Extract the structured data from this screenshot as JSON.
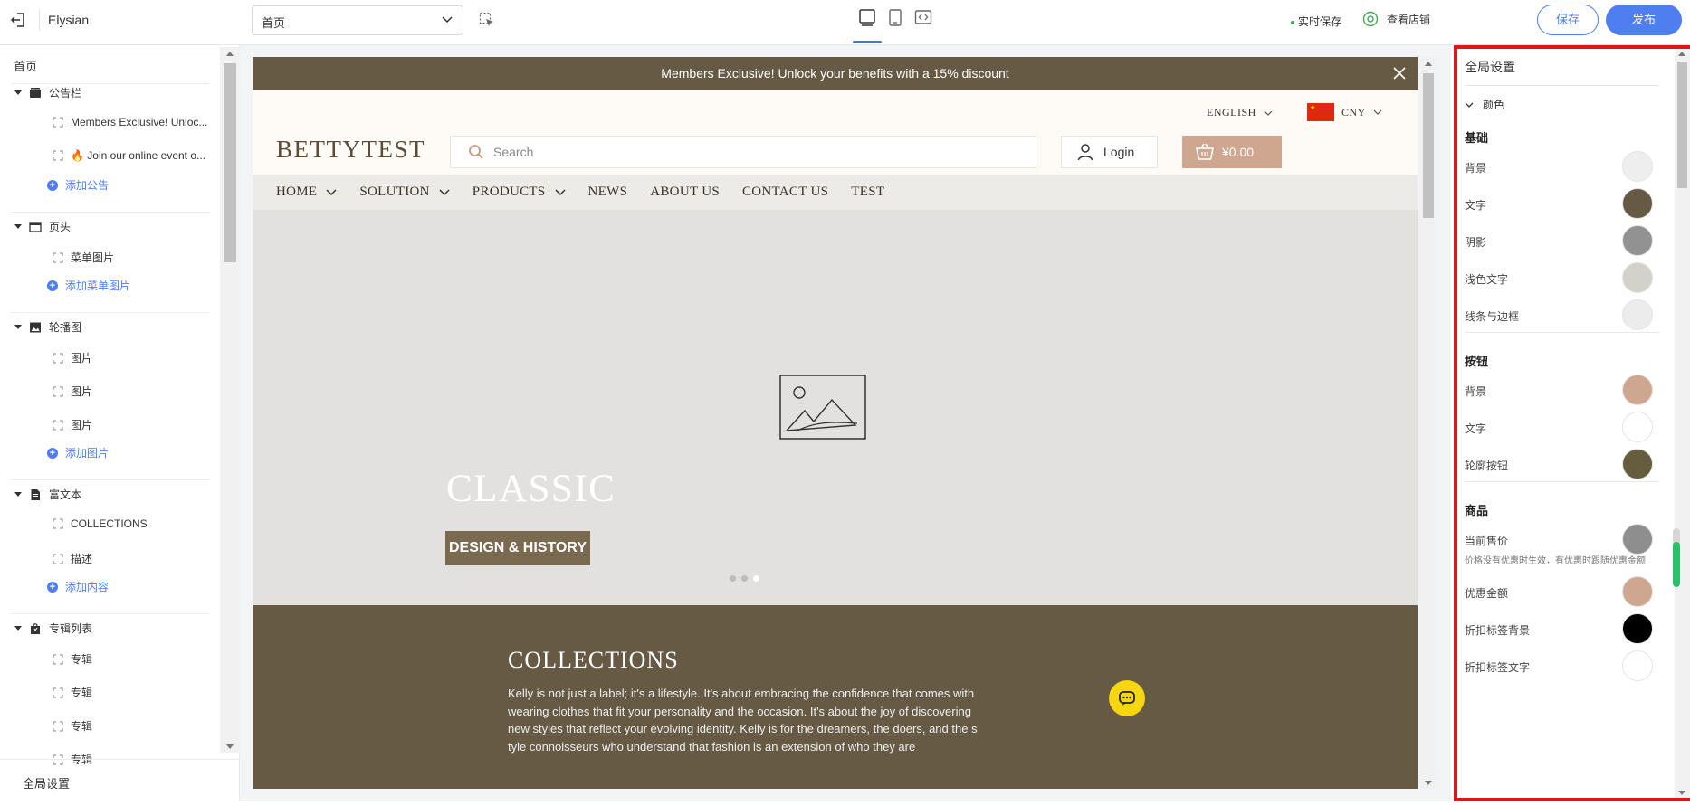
{
  "topbar": {
    "app_name": "Elysian",
    "page_select": "首页",
    "live_save": "实时保存",
    "view_store": "查看店铺",
    "save": "保存",
    "publish": "发布",
    "active_device": "desktop"
  },
  "left": {
    "page_label": "首页",
    "footer": "全局设置",
    "sections": [
      {
        "label": "公告栏",
        "icon": "announcement-icon",
        "items": [
          "Members Exclusive! Unloc...",
          "🔥 Join our online event o..."
        ],
        "add": "添加公告"
      },
      {
        "label": "页头",
        "icon": "header-icon",
        "items": [
          "菜单图片"
        ],
        "add": "添加菜单图片"
      },
      {
        "label": "轮播图",
        "icon": "image-icon",
        "items": [
          "图片",
          "图片",
          "图片"
        ],
        "add": "添加图片"
      },
      {
        "label": "富文本",
        "icon": "document-icon",
        "items": [
          "COLLECTIONS",
          "描述"
        ],
        "add": "添加内容"
      },
      {
        "label": "专辑列表",
        "icon": "collection-icon",
        "items": [
          "专辑",
          "专辑",
          "专辑",
          "专辑"
        ],
        "add": ""
      }
    ]
  },
  "preview": {
    "announcement": "Members Exclusive! Unlock your benefits with a 15% discount",
    "language": "ENGLISH",
    "currency": "CNY",
    "logo": "BETTYTEST",
    "search_placeholder": "Search",
    "login": "Login",
    "cart": "¥0.00",
    "nav": [
      {
        "label": "HOME",
        "dropdown": true
      },
      {
        "label": "SOLUTION",
        "dropdown": true
      },
      {
        "label": "PRODUCTS",
        "dropdown": true
      },
      {
        "label": "NEWS",
        "dropdown": false
      },
      {
        "label": "ABOUT US",
        "dropdown": false
      },
      {
        "label": "CONTACT US",
        "dropdown": false
      },
      {
        "label": "TEST",
        "dropdown": false
      }
    ],
    "hero_title": "CLASSIC",
    "hero_button": "DESIGN & HISTORY",
    "slides_total": 3,
    "active_slide": 3,
    "collections_title": "COLLECTIONS",
    "collections_text": "Kelly is not just a label; it's a lifestyle. It's about embracing the confidence that comes with wearing clothes that fit your personality and the occasion. It's about the joy of discovering new styles that reflect your evolving identity. Kelly is for the dreamers, the doers, and the style connoisseurs who understand that fashion is an extension of who they are"
  },
  "right": {
    "title": "全局设置",
    "color_section": "颜色",
    "groups": [
      {
        "label": "基础",
        "items": [
          {
            "label": "背景",
            "color": "#eeeeee"
          },
          {
            "label": "文字",
            "color": "#665a45"
          },
          {
            "label": "阴影",
            "color": "#929292"
          },
          {
            "label": "浅色文字",
            "color": "#d3d2ca"
          },
          {
            "label": "线条与边框",
            "color": "#ececec"
          }
        ]
      },
      {
        "label": "按钮",
        "items": [
          {
            "label": "背景",
            "color": "#cfa68f"
          },
          {
            "label": "文字",
            "color": "#ffffff"
          },
          {
            "label": "轮廓按钮",
            "color": "#665d3f"
          }
        ]
      },
      {
        "label": "商品",
        "items": [
          {
            "label": "当前售价",
            "color": "#8e8e8e"
          },
          {
            "label": "优惠金额",
            "color": "#cfa68f"
          },
          {
            "label": "折扣标签背景",
            "color": "#000000"
          },
          {
            "label": "折扣标签文字",
            "color": "#ffffff"
          }
        ]
      }
    ],
    "price_note": "价格没有优惠时生效，有优惠时跟随优惠金额"
  }
}
